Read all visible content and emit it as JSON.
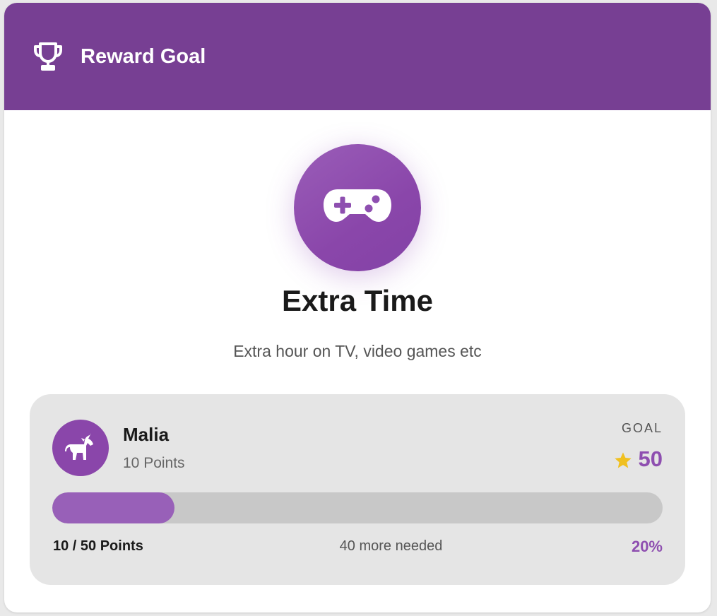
{
  "header": {
    "title": "Reward Goal",
    "icon": "trophy-icon"
  },
  "reward": {
    "icon": "gamepad-icon",
    "title": "Extra Time",
    "description": "Extra hour on TV, video games etc"
  },
  "kid": {
    "name": "Malia",
    "points_text": "10 Points",
    "avatar_icon": "unicorn-icon"
  },
  "goal": {
    "label": "GOAL",
    "value": "50",
    "star_icon": "star-icon"
  },
  "progress": {
    "fraction": 0.2,
    "summary": "10 / 50 Points",
    "remaining": "40 more needed",
    "percent_text": "20%"
  },
  "colors": {
    "header": "#773f93",
    "accent": "#8e4fb0",
    "bar_fill": "#9860b8",
    "bar_track": "#c8c8c8",
    "star": "#f0c020"
  }
}
